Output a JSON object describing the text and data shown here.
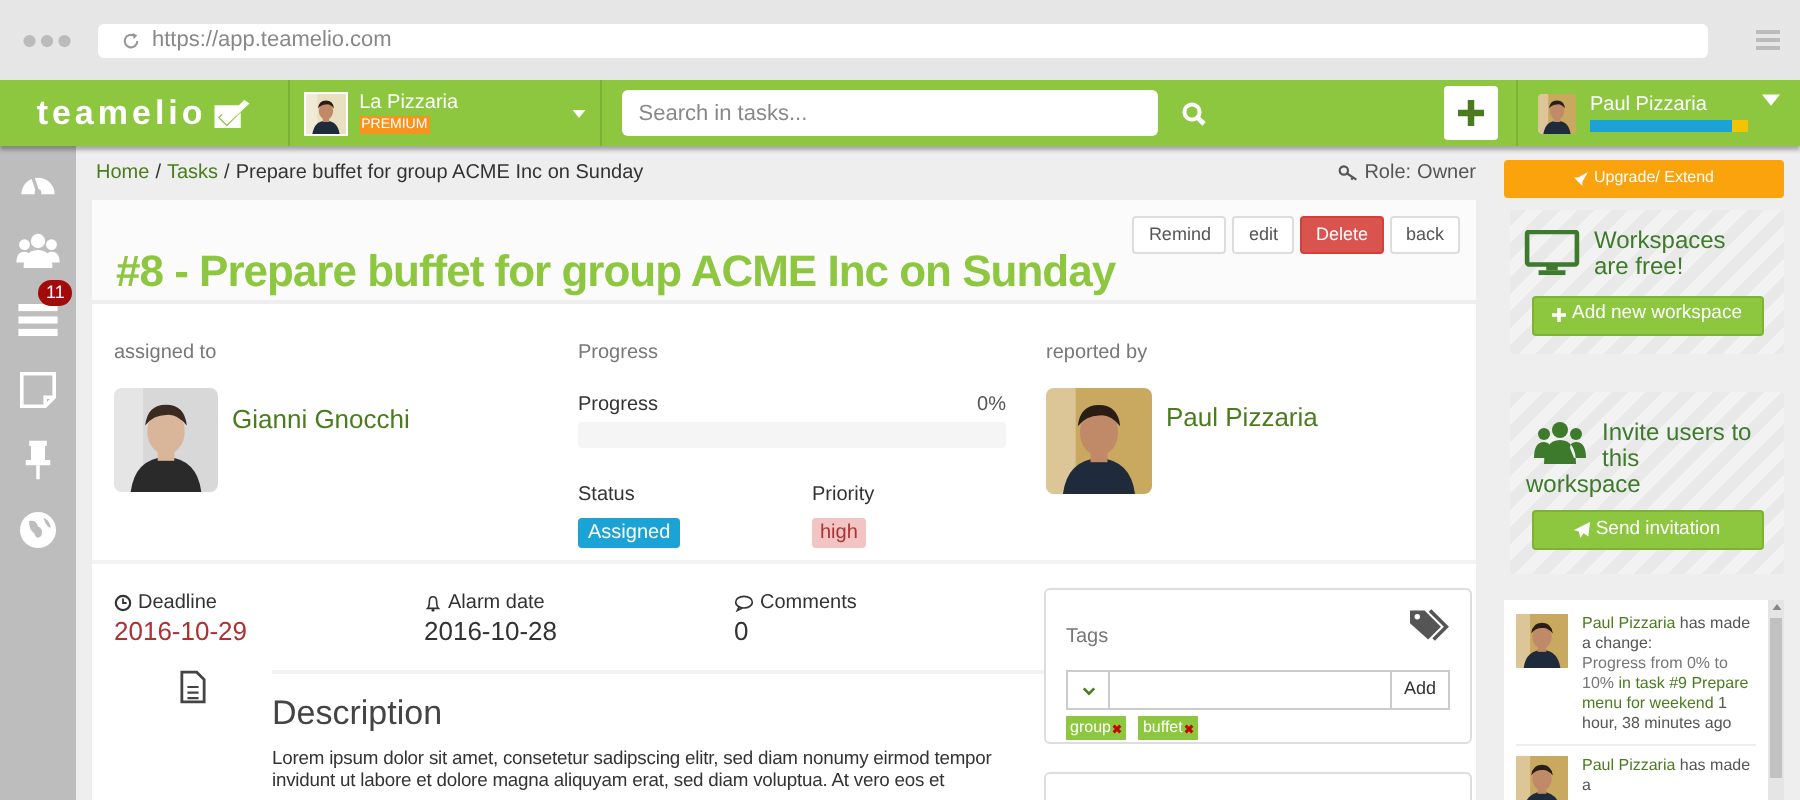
{
  "browser": {
    "url": "https://app.teamelio.com"
  },
  "topbar": {
    "logo": "teamelio",
    "workspace": {
      "name": "La Pizzaria",
      "badge": "PREMIUM"
    },
    "search": {
      "placeholder": "Search in tasks..."
    },
    "user": {
      "name": "Paul Pizzaria",
      "level": 0.9
    }
  },
  "sidebar": {
    "tasks_badge": "11"
  },
  "breadcrumb": [
    {
      "label": "Home",
      "link": true
    },
    {
      "separator": "/",
      "label": "Tasks",
      "link": true
    },
    {
      "separator": "/",
      "label": "Prepare buffet for group ACME Inc on Sunday",
      "link": false
    }
  ],
  "role": {
    "label": "Role:",
    "value": "Owner"
  },
  "task": {
    "title": "#8 - Prepare buffet for group ACME Inc on Sunday",
    "actions": [
      {
        "label": "Remind",
        "kind": "default"
      },
      {
        "label": "edit",
        "kind": "default"
      },
      {
        "label": "Delete",
        "kind": "danger"
      },
      {
        "label": "back",
        "kind": "default"
      }
    ],
    "assigned": {
      "label": "assigned to",
      "name": "Gianni Gnocchi"
    },
    "progress": {
      "heading": "Progress",
      "label": "Progress",
      "reading": "0%",
      "status_label": "Status",
      "status": "Assigned",
      "priority_label": "Priority",
      "priority": "high"
    },
    "reported": {
      "label": "reported by",
      "name": "Paul Pizzaria"
    },
    "meta": [
      {
        "label": "Deadline",
        "value": "2016-10-29",
        "overdue": true
      },
      {
        "label": "Alarm date",
        "value": "2016-10-28",
        "overdue": false
      },
      {
        "label": "Comments",
        "value": "0",
        "overdue": false
      }
    ],
    "description": {
      "title": "Description",
      "text": "Lorem ipsum dolor sit amet, consetetur sadipscing elitr, sed diam nonumy eirmod tempor invidunt ut labore et dolore magna aliquyam erat, sed diam voluptua. At vero eos et"
    },
    "tags": {
      "title": "Tags",
      "button": "Add",
      "items": [
        "group",
        "buffet"
      ]
    }
  },
  "right": {
    "upgrade": "Upgrade/ Extend",
    "workspaces": {
      "text": "Workspaces are free!",
      "button": "Add new workspace"
    },
    "invite": {
      "text_lines": [
        "Invite users to this",
        "workspace"
      ],
      "button": "Send invitation"
    },
    "activity": [
      {
        "user": "Paul Pizzaria",
        "action": "has made a change:",
        "detail": "Progress from 0% to 10%",
        "task": "in task #9 Prepare menu for weekend",
        "time": "1 hour, 38 minutes ago"
      },
      {
        "user": "Paul Pizzaria",
        "action": "has made a"
      }
    ]
  }
}
